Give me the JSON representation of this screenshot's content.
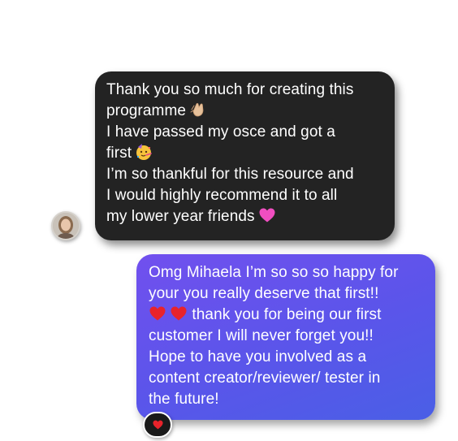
{
  "received_message": {
    "lines": [
      "Thank you so much for creating this",
      "programme",
      "I have passed my osce and got a",
      "first",
      "I’m so thankful for this resource and",
      "I would highly recommend it to all",
      "my lower year friends"
    ],
    "emojis": [
      "clapping-hands",
      "partying-face",
      "pink-heart"
    ],
    "bubble_color": "#232323"
  },
  "sent_message": {
    "lines": [
      "Omg Mihaela I’m so so so happy for",
      "your you really deserve that first!!",
      "thank you for being our first",
      "customer I will never forget you!!",
      "Hope to have you involved as a",
      "content creator/reviewer/ tester in",
      "the future!"
    ],
    "emojis": [
      "red-heart",
      "red-heart"
    ],
    "bubble_color": "#5a55ea"
  },
  "reaction": {
    "emoji": "red-heart"
  }
}
